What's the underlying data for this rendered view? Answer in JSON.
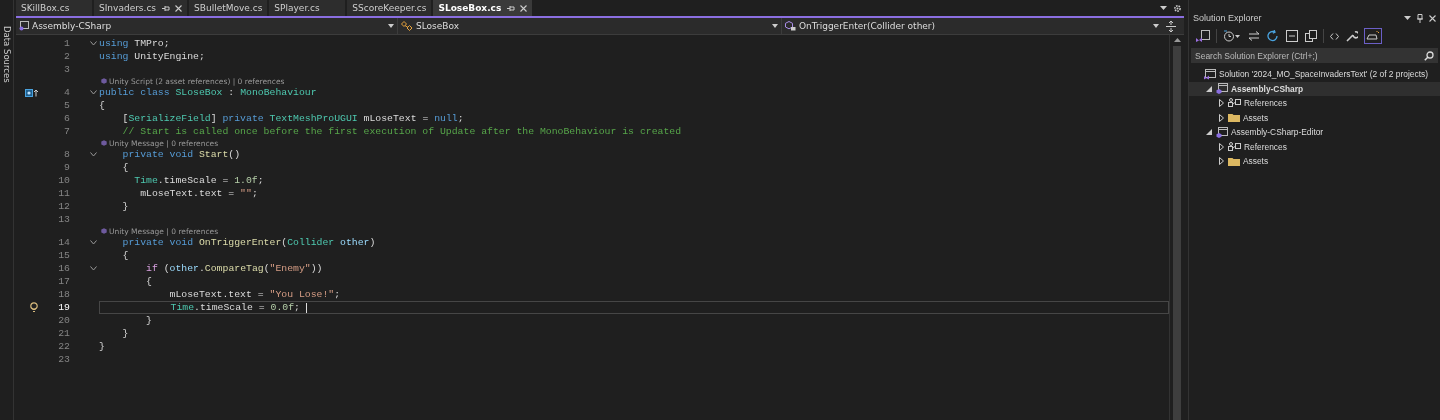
{
  "side_strip": {
    "label": "Data Sources"
  },
  "tabs": [
    {
      "label": "SKillBox.cs",
      "selected": false,
      "pinned": false
    },
    {
      "label": "SInvaders.cs",
      "selected": false,
      "pinned": true
    },
    {
      "label": "SBulletMove.cs",
      "selected": false,
      "pinned": false
    },
    {
      "label": "SPlayer.cs",
      "selected": false,
      "pinned": false
    },
    {
      "label": "SScoreKeeper.cs",
      "selected": false,
      "pinned": false
    },
    {
      "label": "SLoseBox.cs",
      "selected": true,
      "pinned": true
    }
  ],
  "nav_bar": {
    "project": "Assembly-CSharp",
    "class": "SLoseBox",
    "member": "OnTriggerEnter(Collider other)"
  },
  "editor": {
    "lines": [
      {
        "number": "1",
        "fold": true,
        "current": false,
        "tokens": [
          {
            "kind": "kw",
            "text": "using "
          },
          {
            "kind": "plain",
            "text": "TMPro;"
          }
        ]
      },
      {
        "number": "2",
        "fold": false,
        "current": false,
        "tokens": [
          {
            "kind": "kw",
            "text": "using "
          },
          {
            "kind": "plain",
            "text": "UnityEngine;"
          }
        ]
      },
      {
        "number": "3",
        "fold": false,
        "current": false
      },
      {
        "number": "4",
        "fold": true,
        "current": false,
        "margin": {
          "kind": "override"
        },
        "codelens": "Unity Script (2 asset references) | 0 references",
        "tokens": [
          {
            "kind": "kw",
            "text": "public class "
          },
          {
            "kind": "type",
            "text": "SLoseBox"
          },
          {
            "kind": "plain",
            "text": " : "
          },
          {
            "kind": "type",
            "text": "MonoBehaviour"
          }
        ]
      },
      {
        "number": "5",
        "fold": false,
        "current": false,
        "tokens": [
          {
            "kind": "plain",
            "text": "{"
          }
        ]
      },
      {
        "number": "6",
        "fold": false,
        "current": false,
        "tokens": [
          {
            "kind": "plain",
            "text": "    ["
          },
          {
            "kind": "type",
            "text": "SerializeField"
          },
          {
            "kind": "plain",
            "text": "] "
          },
          {
            "kind": "kw",
            "text": "private "
          },
          {
            "kind": "type",
            "text": "TextMeshProUGUI"
          },
          {
            "kind": "plain",
            "text": " mLoseText = "
          },
          {
            "kind": "kw",
            "text": "null"
          },
          {
            "kind": "plain",
            "text": ";"
          }
        ]
      },
      {
        "number": "7",
        "fold": false,
        "current": false,
        "tokens": [
          {
            "kind": "comment",
            "text": "    // Start is called once before the first execution of Update after the MonoBehaviour is created"
          }
        ]
      },
      {
        "number": "8",
        "fold": true,
        "current": false,
        "codelens": "Unity Message | 0 references",
        "tokens": [
          {
            "kind": "kw",
            "text": "    private void "
          },
          {
            "kind": "method",
            "text": "Start"
          },
          {
            "kind": "plain",
            "text": "()"
          }
        ]
      },
      {
        "number": "9",
        "fold": false,
        "current": false,
        "tokens": [
          {
            "kind": "plain",
            "text": "    {"
          }
        ]
      },
      {
        "number": "10",
        "fold": false,
        "current": false,
        "tokens": [
          {
            "kind": "type",
            "text": "      Time"
          },
          {
            "kind": "plain",
            "text": ".timeScale = "
          },
          {
            "kind": "num",
            "text": "1.0f"
          },
          {
            "kind": "plain",
            "text": ";"
          }
        ]
      },
      {
        "number": "11",
        "fold": false,
        "current": false,
        "tokens": [
          {
            "kind": "plain",
            "text": "       mLoseText.text = "
          },
          {
            "kind": "str",
            "text": "\"\""
          },
          {
            "kind": "plain",
            "text": ";"
          }
        ]
      },
      {
        "number": "12",
        "fold": false,
        "current": false,
        "tokens": [
          {
            "kind": "plain",
            "text": "    }"
          }
        ]
      },
      {
        "number": "13",
        "fold": false,
        "current": false
      },
      {
        "number": "14",
        "fold": true,
        "current": false,
        "codelens": "Unity Message | 0 references",
        "tokens": [
          {
            "kind": "kw",
            "text": "    private void "
          },
          {
            "kind": "method",
            "text": "OnTriggerEnter"
          },
          {
            "kind": "plain",
            "text": "("
          },
          {
            "kind": "type",
            "text": "Collider "
          },
          {
            "kind": "param",
            "text": "other"
          },
          {
            "kind": "plain",
            "text": ")"
          }
        ]
      },
      {
        "number": "15",
        "fold": false,
        "current": false,
        "tokens": [
          {
            "kind": "plain",
            "text": "    {"
          }
        ]
      },
      {
        "number": "16",
        "fold": true,
        "current": false,
        "tokens": [
          {
            "kind": "ctrl",
            "text": "        if "
          },
          {
            "kind": "plain",
            "text": "("
          },
          {
            "kind": "param",
            "text": "other"
          },
          {
            "kind": "plain",
            "text": "."
          },
          {
            "kind": "method",
            "text": "CompareTag"
          },
          {
            "kind": "plain",
            "text": "("
          },
          {
            "kind": "str",
            "text": "\"Enemy\""
          },
          {
            "kind": "plain",
            "text": "))"
          }
        ]
      },
      {
        "number": "17",
        "fold": false,
        "current": false,
        "tokens": [
          {
            "kind": "plain",
            "text": "        {"
          }
        ]
      },
      {
        "number": "18",
        "fold": false,
        "current": false,
        "tokens": [
          {
            "kind": "plain",
            "text": "            mLoseText.text = "
          },
          {
            "kind": "str",
            "text": "\"You Lose!\""
          },
          {
            "kind": "plain",
            "text": ";"
          }
        ]
      },
      {
        "number": "19",
        "fold": false,
        "current": true,
        "margin": {
          "kind": "lightbulb"
        },
        "tokens": [
          {
            "kind": "type",
            "text": "            Time"
          },
          {
            "kind": "plain",
            "text": ".timeScale = "
          },
          {
            "kind": "num",
            "text": "0.0f"
          },
          {
            "kind": "plain",
            "text": "; "
          }
        ]
      },
      {
        "number": "20",
        "fold": false,
        "current": false,
        "tokens": [
          {
            "kind": "plain",
            "text": "        }"
          }
        ]
      },
      {
        "number": "21",
        "fold": false,
        "current": false,
        "tokens": [
          {
            "kind": "plain",
            "text": "    }"
          }
        ]
      },
      {
        "number": "22",
        "fold": false,
        "current": false,
        "tokens": [
          {
            "kind": "plain",
            "text": "}"
          }
        ]
      },
      {
        "number": "23",
        "fold": false,
        "current": false
      }
    ]
  },
  "solution_explorer": {
    "title": "Solution Explorer",
    "search": {
      "placeholder": "Search Solution Explorer (Ctrl+;)"
    },
    "tree": [
      {
        "label": "Solution '2024_MO_SpaceInvadersText' (2 of 2 projects)",
        "kind": "solution",
        "selected": false,
        "children": [
          {
            "label": "Assembly-CSharp",
            "kind": "project",
            "expanded": true,
            "selected": true,
            "children": [
              {
                "label": "References",
                "kind": "references",
                "expanded": false,
                "selected": false
              },
              {
                "label": "Assets",
                "kind": "folder",
                "expanded": false,
                "selected": false
              }
            ]
          },
          {
            "label": "Assembly-CSharp-Editor",
            "kind": "project",
            "expanded": true,
            "selected": false,
            "children": [
              {
                "label": "References",
                "kind": "references",
                "expanded": false,
                "selected": false
              },
              {
                "label": "Assets",
                "kind": "folder",
                "expanded": false,
                "selected": false
              }
            ]
          }
        ]
      }
    ]
  }
}
